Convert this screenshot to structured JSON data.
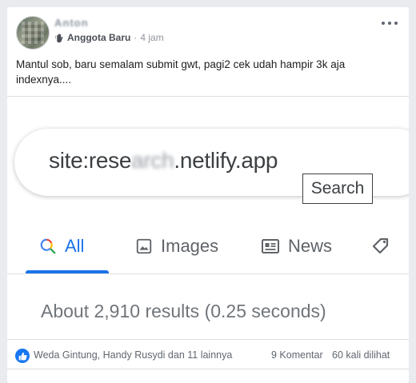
{
  "post": {
    "author": "Anton",
    "badge": "Anggota Baru",
    "separator": "·",
    "time": "4 jam",
    "text": "Mantul sob, baru semalam submit gwt, pagi2 cek udah hampir 3k aja indexnya....",
    "more_icon": "ellipsis-icon",
    "badge_icon": "hand-wave-icon"
  },
  "screenshot": {
    "query_prefix": "site:rese",
    "query_hidden": "arch",
    "query_suffix": ".netlify.app",
    "tooltip": "Search",
    "tabs": [
      {
        "label": "All",
        "icon": "search-icon",
        "active": true
      },
      {
        "label": "Images",
        "icon": "image-icon",
        "active": false
      },
      {
        "label": "News",
        "icon": "news-icon",
        "active": false
      },
      {
        "label": "",
        "icon": "tag-icon",
        "active": false
      }
    ],
    "results_stats": "About 2,910 results (0.25 seconds)",
    "colors": {
      "accent": "#1a73e8",
      "text": "#3c4043",
      "muted": "#70757a"
    }
  },
  "footer": {
    "reactors": "Weda Gintung, Handy Rusydi dan 11 lainnya",
    "comments": "9 Komentar",
    "views": "60 kali dilihat",
    "like_icon": "like-icon",
    "like_color": "#1877f2"
  }
}
